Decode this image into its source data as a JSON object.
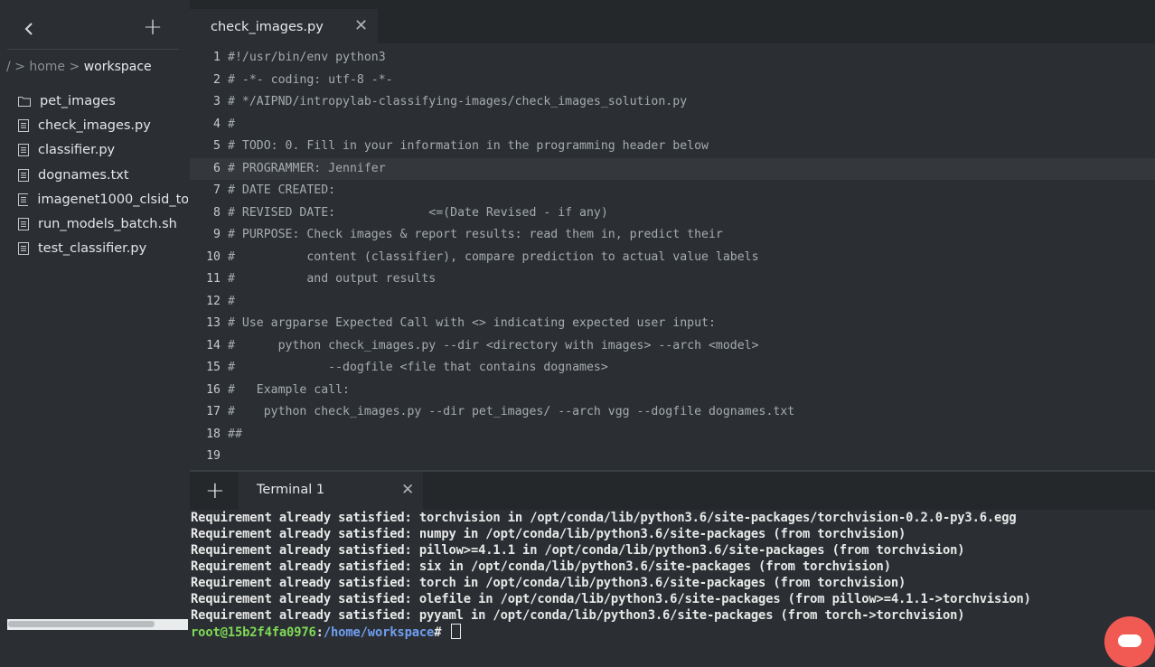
{
  "sidebar": {
    "back_icon": "chevron-left-icon",
    "add_icon": "plus-icon",
    "add_symbol": "+",
    "breadcrumb": {
      "sep1": "/ > ",
      "home": "home",
      "sep2": " > ",
      "current": "workspace"
    },
    "files": [
      {
        "name": "pet_images",
        "type": "folder",
        "icon": "folder-icon"
      },
      {
        "name": "check_images.py",
        "type": "file",
        "icon": "file-icon"
      },
      {
        "name": "classifier.py",
        "type": "file",
        "icon": "file-icon"
      },
      {
        "name": "dognames.txt",
        "type": "file",
        "icon": "file-icon"
      },
      {
        "name": "imagenet1000_clsid_to_",
        "type": "file",
        "icon": "file-icon"
      },
      {
        "name": "run_models_batch.sh",
        "type": "file",
        "icon": "file-icon"
      },
      {
        "name": "test_classifier.py",
        "type": "file",
        "icon": "file-icon"
      }
    ]
  },
  "editor": {
    "tab": {
      "label": "check_images.py",
      "close": "✕"
    },
    "highlighted_line": 6,
    "lines": [
      {
        "n": "1",
        "text": "#!/usr/bin/env python3"
      },
      {
        "n": "2",
        "text": "# -*- coding: utf-8 -*-"
      },
      {
        "n": "3",
        "text": "# */AIPND/intropylab-classifying-images/check_images_solution.py"
      },
      {
        "n": "4",
        "text": "#"
      },
      {
        "n": "5",
        "text": "# TODO: 0. Fill in your information in the programming header below"
      },
      {
        "n": "6",
        "text": "# PROGRAMMER: Jennifer"
      },
      {
        "n": "7",
        "text": "# DATE CREATED:"
      },
      {
        "n": "8",
        "text": "# REVISED DATE:             <=(Date Revised - if any)"
      },
      {
        "n": "9",
        "text": "# PURPOSE: Check images & report results: read them in, predict their"
      },
      {
        "n": "10",
        "text": "#          content (classifier), compare prediction to actual value labels"
      },
      {
        "n": "11",
        "text": "#          and output results"
      },
      {
        "n": "12",
        "text": "#"
      },
      {
        "n": "13",
        "text": "# Use argparse Expected Call with <> indicating expected user input:"
      },
      {
        "n": "14",
        "text": "#      python check_images.py --dir <directory with images> --arch <model>"
      },
      {
        "n": "15",
        "text": "#             --dogfile <file that contains dognames>"
      },
      {
        "n": "16",
        "text": "#   Example call:"
      },
      {
        "n": "17",
        "text": "#    python check_images.py --dir pet_images/ --arch vgg --dogfile dognames.txt"
      },
      {
        "n": "18",
        "text": "##"
      },
      {
        "n": "19",
        "text": ""
      }
    ]
  },
  "terminal": {
    "add_symbol": "+",
    "tab": {
      "label": "Terminal 1",
      "close": "✕"
    },
    "output": [
      "Requirement already satisfied: torchvision in /opt/conda/lib/python3.6/site-packages/torchvision-0.2.0-py3.6.egg",
      "Requirement already satisfied: numpy in /opt/conda/lib/python3.6/site-packages (from torchvision)",
      "Requirement already satisfied: pillow>=4.1.1 in /opt/conda/lib/python3.6/site-packages (from torchvision)",
      "Requirement already satisfied: six in /opt/conda/lib/python3.6/site-packages (from torchvision)",
      "Requirement already satisfied: torch in /opt/conda/lib/python3.6/site-packages (from torchvision)",
      "Requirement already satisfied: olefile in /opt/conda/lib/python3.6/site-packages (from pillow>=4.1.1->torchvision)",
      "Requirement already satisfied: pyyaml in /opt/conda/lib/python3.6/site-packages (from torch->torchvision)"
    ],
    "prompt": {
      "user": "root@15b2f4fa0976",
      "sep": ":",
      "path": "/home/workspace",
      "symbol": "# "
    }
  },
  "colors": {
    "background": "#2b2f33",
    "tabbar": "#25282b",
    "prompt_user": "#7ed957",
    "prompt_path": "#6f9ef0",
    "chat_bubble": "#f05a53"
  },
  "chat_widget": {
    "icon": "chat-bubble-icon"
  }
}
